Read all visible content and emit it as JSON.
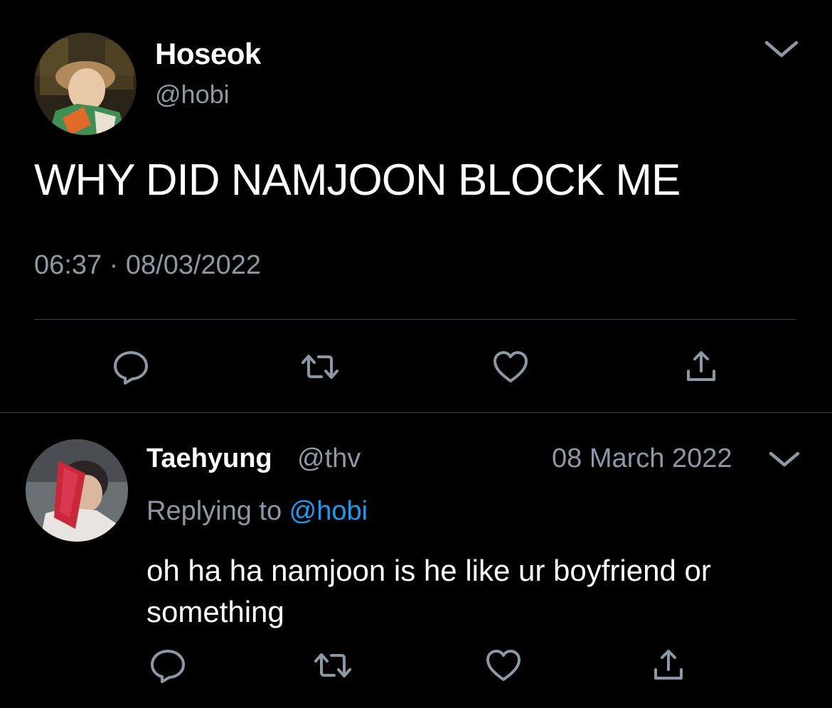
{
  "main_tweet": {
    "author_name": "Hoseok",
    "author_handle": "@hobi",
    "text": "WHY DID NAMJOON BLOCK ME",
    "timestamp": "06:37 · 08/03/2022",
    "actions": {
      "reply_icon": "reply-icon",
      "retweet_icon": "retweet-icon",
      "like_icon": "heart-icon",
      "share_icon": "share-icon"
    }
  },
  "reply_tweet": {
    "author_name": "Taehyung",
    "author_handle": "@thv",
    "date": "08 March 2022",
    "replying_prefix": "Replying to ",
    "replying_to": "@hobi",
    "text": "oh ha ha namjoon is he like ur boyfriend or something",
    "actions": {
      "reply_icon": "reply-icon",
      "retweet_icon": "retweet-icon",
      "like_icon": "heart-icon",
      "share_icon": "share-icon"
    }
  },
  "colors": {
    "background": "#000000",
    "primary_text": "#ffffff",
    "secondary_text": "#8b98a5",
    "link": "#1d9bf0",
    "divider": "#38444d"
  }
}
